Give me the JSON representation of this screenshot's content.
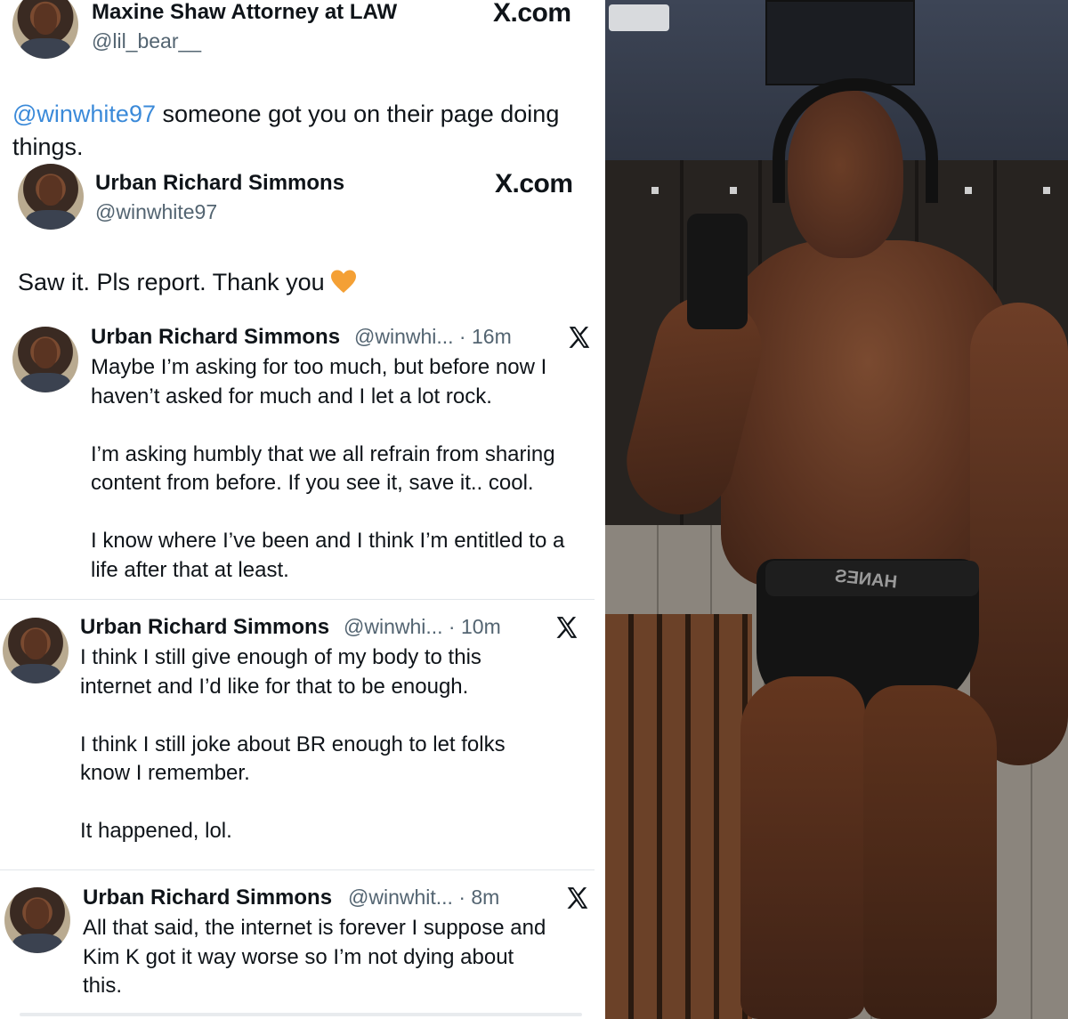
{
  "card1": {
    "name": "Maxine Shaw Attorney at LAW",
    "handle": "@lil_bear__",
    "brand": "X.com",
    "mention": "@winwhite97",
    "text": " someone got you on their page doing things."
  },
  "card2": {
    "name": "Urban Richard Simmons",
    "handle": "@winwhite97",
    "brand": "X.com",
    "text": "Saw it. Pls report. Thank you"
  },
  "tweets": [
    {
      "name": "Urban Richard Simmons",
      "meta": "@winwhi... · 16m",
      "text": "Maybe I’m asking for too much, but before now I\nhaven’t asked for much and I let a lot rock.\n\nI’m asking humbly that we all refrain from sharing\ncontent from before. If you see it, save it.. cool.\n\nI know where I’ve been and I think I’m entitled to a\nlife after that at least."
    },
    {
      "name": "Urban Richard Simmons",
      "meta": "@winwhi... · 10m",
      "text": "I think I still give enough of my body to this\ninternet and I’d like for that to be enough.\n\nI think I still joke about BR enough to let folks\nknow I remember.\n\nIt happened, lol."
    },
    {
      "name": "Urban Richard Simmons",
      "meta": "@winwhit... · 8m",
      "text": "All that said, the internet is forever I suppose and\nKim K got it way worse so I’m not dying about\nthis."
    }
  ],
  "photo": {
    "waistband_text": "HANES"
  },
  "colors": {
    "mention": "#3b8ad9",
    "handle": "#536471",
    "heart": "#f4a035"
  }
}
